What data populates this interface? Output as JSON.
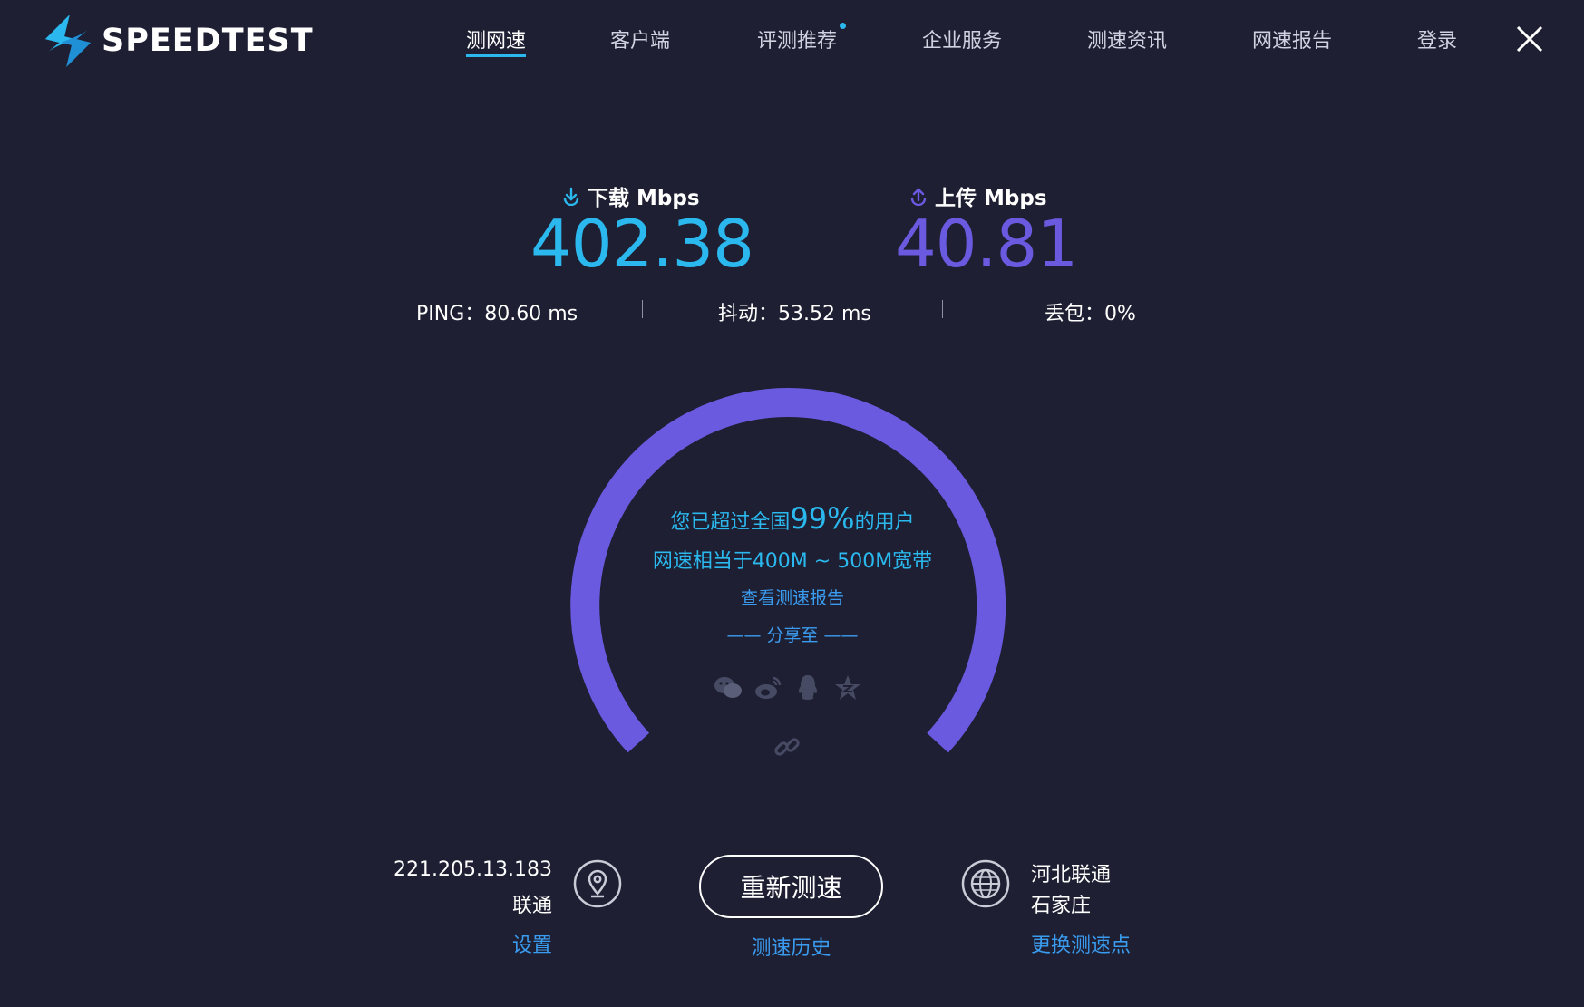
{
  "header": {
    "logo_text": "SPEEDTEST",
    "nav": [
      {
        "label": "测网速",
        "active": true
      },
      {
        "label": "客户端"
      },
      {
        "label": "评测推荐",
        "dot": true
      },
      {
        "label": "企业服务"
      },
      {
        "label": "测速资讯"
      },
      {
        "label": "网速报告"
      },
      {
        "label": "登录"
      }
    ]
  },
  "results": {
    "download": {
      "label": "下载 Mbps",
      "value": "402.38",
      "color": "#2ab8ee"
    },
    "upload": {
      "label": "上传 Mbps",
      "value": "40.81",
      "color": "#6a5ae0"
    },
    "ping": "PING：80.60 ms",
    "jitter": "抖动：53.52 ms",
    "loss": "丢包：0%"
  },
  "gauge": {
    "color": "#6a5ae0",
    "line1_pre": "您已超过全国",
    "line1_pct": "99%",
    "line1_post": "的用户",
    "line2": "网速相当于400M ~ 500M宽带",
    "report_link": "查看测速报告",
    "share_label": "—— 分享至 ——",
    "share_icons": [
      "wechat-icon",
      "weibo-icon",
      "qq-icon",
      "qzone-icon"
    ],
    "copy_link_icon": "link-icon"
  },
  "bottom": {
    "ip": "221.205.13.183",
    "isp": "联通",
    "settings": "设置",
    "retest": "重新测速",
    "history": "测速历史",
    "server_name": "河北联通",
    "server_city": "石家庄",
    "change_server": "更换测速点"
  }
}
